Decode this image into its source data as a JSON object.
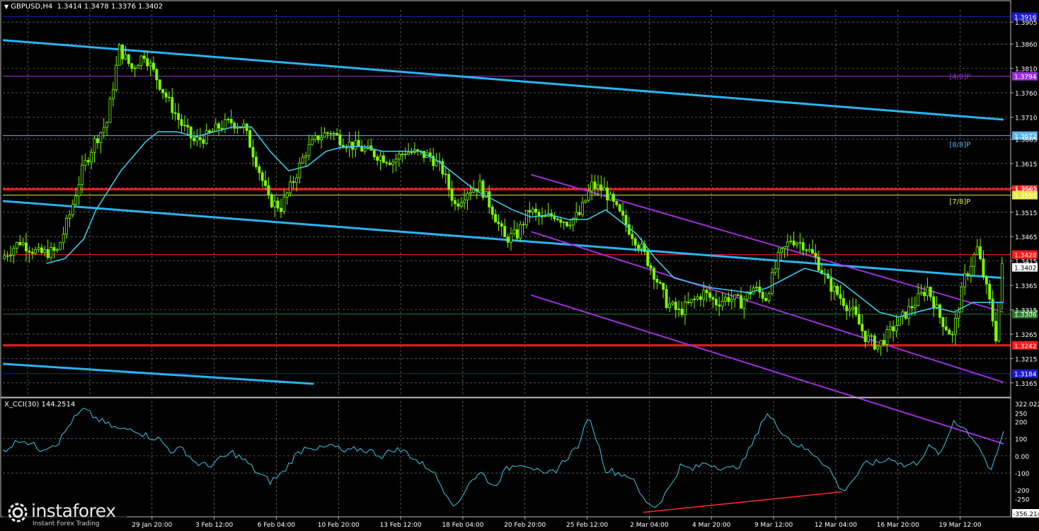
{
  "header": {
    "symbol": "GBPUSD,H4",
    "open": "1.3414",
    "high": "1.3478",
    "low": "1.3376",
    "close": "1.3402"
  },
  "indicator": {
    "label": "X_CCI(30) 144.2514",
    "max_label": "322.0224",
    "min_label": "-356.2141"
  },
  "logo": {
    "name": "instaforex",
    "tagline": "Instant Forex Trading"
  },
  "chart_data": {
    "type": "candlestick",
    "instrument": "GBPUSD",
    "timeframe": "H4",
    "price_axis": {
      "min": 1.314,
      "max": 1.393,
      "ticks": [
        "1.3905",
        "1.3860",
        "1.3810",
        "1.3760",
        "1.3710",
        "1.3665",
        "1.3615",
        "1.3565",
        "1.3515",
        "1.3465",
        "1.3415",
        "1.3365",
        "1.3315",
        "1.3265",
        "1.3215",
        "1.3165"
      ],
      "tick_values": [
        1.3905,
        1.386,
        1.381,
        1.376,
        1.371,
        1.3665,
        1.3615,
        1.3565,
        1.3515,
        1.3465,
        1.3415,
        1.3365,
        1.3315,
        1.3265,
        1.3215,
        1.3165
      ]
    },
    "time_axis": {
      "labels": [
        "29 Jan 20:00",
        "3 Feb 12:00",
        "6 Feb 04:00",
        "10 Feb 20:00",
        "13 Feb 12:00",
        "18 Feb 04:00",
        "20 Feb 20:00",
        "25 Feb 12:00",
        "2 Mar 04:00",
        "4 Mar 20:00",
        "9 Mar 12:00",
        "12 Mar 04:00",
        "16 Mar 20:00",
        "19 Mar 12:00"
      ],
      "bar_index": [
        48,
        68,
        88,
        108,
        128,
        148,
        168,
        188,
        208,
        228,
        248,
        268,
        288,
        308
      ]
    },
    "bar_count": 322,
    "close_path": [
      [
        0,
        1.342
      ],
      [
        6,
        1.3455
      ],
      [
        12,
        1.343
      ],
      [
        18,
        1.3435
      ],
      [
        22,
        1.351
      ],
      [
        26,
        1.36
      ],
      [
        30,
        1.366
      ],
      [
        34,
        1.37
      ],
      [
        38,
        1.385
      ],
      [
        42,
        1.381
      ],
      [
        46,
        1.384
      ],
      [
        50,
        1.379
      ],
      [
        54,
        1.374
      ],
      [
        58,
        1.3695
      ],
      [
        62,
        1.366
      ],
      [
        66,
        1.367
      ],
      [
        70,
        1.369
      ],
      [
        74,
        1.37
      ],
      [
        78,
        1.369
      ],
      [
        82,
        1.362
      ],
      [
        86,
        1.354
      ],
      [
        90,
        1.3525
      ],
      [
        94,
        1.358
      ],
      [
        98,
        1.364
      ],
      [
        102,
        1.367
      ],
      [
        106,
        1.368
      ],
      [
        110,
        1.366
      ],
      [
        114,
        1.365
      ],
      [
        118,
        1.364
      ],
      [
        122,
        1.363
      ],
      [
        126,
        1.362
      ],
      [
        130,
        1.364
      ],
      [
        134,
        1.3635
      ],
      [
        138,
        1.363
      ],
      [
        142,
        1.36
      ],
      [
        146,
        1.353
      ],
      [
        150,
        1.356
      ],
      [
        154,
        1.357
      ],
      [
        158,
        1.352
      ],
      [
        162,
        1.346
      ],
      [
        166,
        1.347
      ],
      [
        170,
        1.352
      ],
      [
        174,
        1.35
      ],
      [
        178,
        1.351
      ],
      [
        182,
        1.3495
      ],
      [
        186,
        1.351
      ],
      [
        190,
        1.357
      ],
      [
        194,
        1.356
      ],
      [
        198,
        1.352
      ],
      [
        202,
        1.348
      ],
      [
        206,
        1.344
      ],
      [
        210,
        1.339
      ],
      [
        214,
        1.333
      ],
      [
        218,
        1.331
      ],
      [
        222,
        1.333
      ],
      [
        226,
        1.335
      ],
      [
        230,
        1.333
      ],
      [
        234,
        1.334
      ],
      [
        238,
        1.333
      ],
      [
        242,
        1.336
      ],
      [
        246,
        1.334
      ],
      [
        250,
        1.342
      ],
      [
        254,
        1.346
      ],
      [
        258,
        1.345
      ],
      [
        262,
        1.342
      ],
      [
        266,
        1.337
      ],
      [
        270,
        1.334
      ],
      [
        274,
        1.331
      ],
      [
        278,
        1.326
      ],
      [
        282,
        1.324
      ],
      [
        286,
        1.327
      ],
      [
        290,
        1.33
      ],
      [
        294,
        1.333
      ],
      [
        298,
        1.336
      ],
      [
        302,
        1.33
      ],
      [
        306,
        1.326
      ],
      [
        310,
        1.338
      ],
      [
        314,
        1.344
      ],
      [
        318,
        1.333
      ],
      [
        320,
        1.326
      ],
      [
        322,
        1.3402
      ]
    ],
    "ma_path": [
      [
        14,
        1.341
      ],
      [
        20,
        1.342
      ],
      [
        26,
        1.346
      ],
      [
        30,
        1.352
      ],
      [
        34,
        1.356
      ],
      [
        38,
        1.36
      ],
      [
        42,
        1.363
      ],
      [
        46,
        1.366
      ],
      [
        50,
        1.368
      ],
      [
        56,
        1.368
      ],
      [
        62,
        1.367
      ],
      [
        68,
        1.368
      ],
      [
        74,
        1.369
      ],
      [
        80,
        1.369
      ],
      [
        86,
        1.364
      ],
      [
        92,
        1.36
      ],
      [
        98,
        1.361
      ],
      [
        104,
        1.364
      ],
      [
        110,
        1.365
      ],
      [
        116,
        1.365
      ],
      [
        122,
        1.364
      ],
      [
        128,
        1.364
      ],
      [
        134,
        1.364
      ],
      [
        140,
        1.362
      ],
      [
        146,
        1.359
      ],
      [
        152,
        1.356
      ],
      [
        158,
        1.354
      ],
      [
        164,
        1.352
      ],
      [
        170,
        1.3505
      ],
      [
        176,
        1.351
      ],
      [
        182,
        1.35
      ],
      [
        188,
        1.35
      ],
      [
        194,
        1.352
      ],
      [
        198,
        1.35
      ],
      [
        204,
        1.347
      ],
      [
        210,
        1.342
      ],
      [
        216,
        1.338
      ],
      [
        222,
        1.337
      ],
      [
        228,
        1.336
      ],
      [
        234,
        1.3355
      ],
      [
        240,
        1.335
      ],
      [
        246,
        1.336
      ],
      [
        252,
        1.338
      ],
      [
        258,
        1.34
      ],
      [
        264,
        1.339
      ],
      [
        270,
        1.337
      ],
      [
        276,
        1.334
      ],
      [
        282,
        1.331
      ],
      [
        288,
        1.33
      ],
      [
        294,
        1.331
      ],
      [
        300,
        1.332
      ],
      [
        306,
        1.331
      ],
      [
        312,
        1.333
      ],
      [
        318,
        1.333
      ],
      [
        322,
        1.333
      ]
    ],
    "levels": [
      {
        "value": 1.3916,
        "label": "1.3916",
        "color": "#1c1cc8",
        "width": 1
      },
      {
        "value": 1.3794,
        "label": "1.3794",
        "color": "#9b30d8",
        "width": 1
      },
      {
        "value": 1.3672,
        "label": "1.3672",
        "color": "#5ab4e6",
        "width": 1
      },
      {
        "value": 1.3562,
        "label": "1.3562",
        "color": "#ff1a1a",
        "width": 3
      },
      {
        "value": 1.355,
        "label": "1.3550",
        "color": "#e6e64a",
        "width": 1
      },
      {
        "value": 1.3428,
        "label": "1.3428",
        "color": "#ff1a1a",
        "width": 1
      },
      {
        "value": 1.3306,
        "label": "1.3306",
        "color": "#2a7a2a",
        "width": 1
      },
      {
        "value": 1.3242,
        "label": "1.3242",
        "color": "#ff1a1a",
        "width": 3
      },
      {
        "value": 1.3184,
        "label": "1.3184",
        "color": "#1c1cc8",
        "width": 1
      }
    ],
    "current_price": {
      "value": 1.3402,
      "label": "1.3402"
    },
    "murrey_labels": [
      {
        "text": "[4/8]P",
        "value": 1.3794,
        "color": "#9b30d8"
      },
      {
        "text": "[8/8]P",
        "value": 1.3655,
        "color": "#5ab4e6"
      },
      {
        "text": "[7/8]P",
        "value": 1.3538,
        "color": "#e6e64a"
      }
    ],
    "trend_lines": [
      {
        "color": "#28b4f0",
        "width": 3,
        "from": [
          0,
          1.3868
        ],
        "to": [
          322,
          1.3705
        ]
      },
      {
        "color": "#28b4f0",
        "width": 3,
        "from": [
          0,
          1.3538
        ],
        "to": [
          322,
          1.338
        ]
      },
      {
        "color": "#28b4f0",
        "width": 3,
        "from": [
          0,
          1.3204
        ],
        "to": [
          100,
          1.3163
        ]
      }
    ],
    "channel_lines": [
      {
        "color": "#9b30d8",
        "width": 2,
        "from": [
          170,
          1.3592
        ],
        "to": [
          322,
          1.331
        ]
      },
      {
        "color": "#9b30d8",
        "width": 2,
        "from": [
          170,
          1.3475
        ],
        "to": [
          322,
          1.3166
        ]
      },
      {
        "color": "#9b30d8",
        "width": 2,
        "from": [
          170,
          1.3345
        ],
        "to": [
          322,
          1.304
        ]
      }
    ],
    "cci": {
      "min": -356.2141,
      "max": 322.0224,
      "ticks": [
        "250",
        "200",
        "100",
        "0.00",
        "-100",
        "-200",
        "-250"
      ],
      "tick_values": [
        250,
        200,
        100,
        0,
        -100,
        -200,
        -250
      ],
      "path": [
        [
          0,
          30
        ],
        [
          6,
          100
        ],
        [
          12,
          40
        ],
        [
          18,
          80
        ],
        [
          22,
          200
        ],
        [
          26,
          270
        ],
        [
          30,
          220
        ],
        [
          34,
          180
        ],
        [
          38,
          150
        ],
        [
          42,
          160
        ],
        [
          46,
          120
        ],
        [
          50,
          100
        ],
        [
          54,
          30
        ],
        [
          58,
          40
        ],
        [
          62,
          -40
        ],
        [
          66,
          -60
        ],
        [
          70,
          -20
        ],
        [
          74,
          20
        ],
        [
          78,
          -30
        ],
        [
          82,
          -100
        ],
        [
          86,
          -150
        ],
        [
          90,
          -100
        ],
        [
          94,
          0
        ],
        [
          98,
          60
        ],
        [
          102,
          40
        ],
        [
          106,
          60
        ],
        [
          110,
          20
        ],
        [
          114,
          40
        ],
        [
          118,
          30
        ],
        [
          122,
          0
        ],
        [
          126,
          40
        ],
        [
          130,
          20
        ],
        [
          134,
          -40
        ],
        [
          138,
          -80
        ],
        [
          142,
          -200
        ],
        [
          146,
          -300
        ],
        [
          150,
          -150
        ],
        [
          154,
          -100
        ],
        [
          158,
          -180
        ],
        [
          162,
          -80
        ],
        [
          166,
          -40
        ],
        [
          170,
          -60
        ],
        [
          174,
          -120
        ],
        [
          178,
          -80
        ],
        [
          182,
          0
        ],
        [
          186,
          80
        ],
        [
          188,
          230
        ],
        [
          190,
          160
        ],
        [
          194,
          -80
        ],
        [
          198,
          -100
        ],
        [
          202,
          -120
        ],
        [
          206,
          -250
        ],
        [
          210,
          -300
        ],
        [
          214,
          -200
        ],
        [
          218,
          -60
        ],
        [
          222,
          -80
        ],
        [
          226,
          -40
        ],
        [
          230,
          -60
        ],
        [
          234,
          -80
        ],
        [
          238,
          -40
        ],
        [
          242,
          100
        ],
        [
          244,
          200
        ],
        [
          246,
          240
        ],
        [
          250,
          160
        ],
        [
          254,
          80
        ],
        [
          258,
          40
        ],
        [
          262,
          0
        ],
        [
          266,
          -80
        ],
        [
          270,
          -210
        ],
        [
          274,
          -130
        ],
        [
          278,
          -40
        ],
        [
          282,
          -40
        ],
        [
          286,
          -10
        ],
        [
          290,
          -60
        ],
        [
          294,
          -40
        ],
        [
          298,
          50
        ],
        [
          302,
          10
        ],
        [
          306,
          210
        ],
        [
          310,
          150
        ],
        [
          314,
          60
        ],
        [
          318,
          -100
        ],
        [
          322,
          144
        ]
      ],
      "divergence_line": {
        "color": "#ff2a2a",
        "from": [
          206,
          -330
        ],
        "to": [
          270,
          -210
        ]
      }
    }
  }
}
